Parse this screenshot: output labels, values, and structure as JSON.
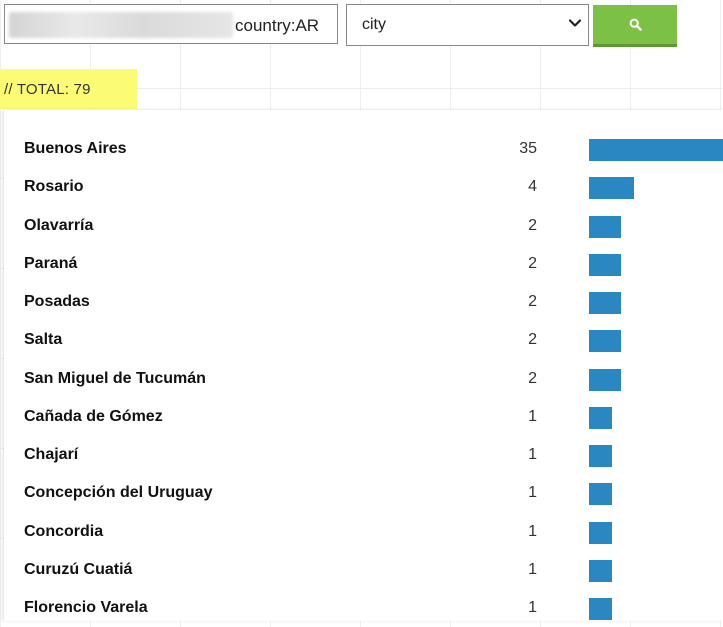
{
  "search": {
    "query_text": "country:AR",
    "field_selected": "city",
    "button_color": "#7cc146"
  },
  "total": {
    "label": "// TOTAL: 79"
  },
  "results": {
    "bar_color": "#2b87c1",
    "max_count": 35,
    "items": [
      {
        "city": "Buenos Aires",
        "count": 35
      },
      {
        "city": "Rosario",
        "count": 4
      },
      {
        "city": "Olavarría",
        "count": 2
      },
      {
        "city": "Paraná",
        "count": 2
      },
      {
        "city": "Posadas",
        "count": 2
      },
      {
        "city": "Salta",
        "count": 2
      },
      {
        "city": "San Miguel de Tucumán",
        "count": 2
      },
      {
        "city": "Cañada de Gómez",
        "count": 1
      },
      {
        "city": "Chajarí",
        "count": 1
      },
      {
        "city": "Concepción del Uruguay",
        "count": 1
      },
      {
        "city": "Concordia",
        "count": 1
      },
      {
        "city": "Curuzú Cuatiá",
        "count": 1
      },
      {
        "city": "Florencio Varela",
        "count": 1
      }
    ]
  }
}
